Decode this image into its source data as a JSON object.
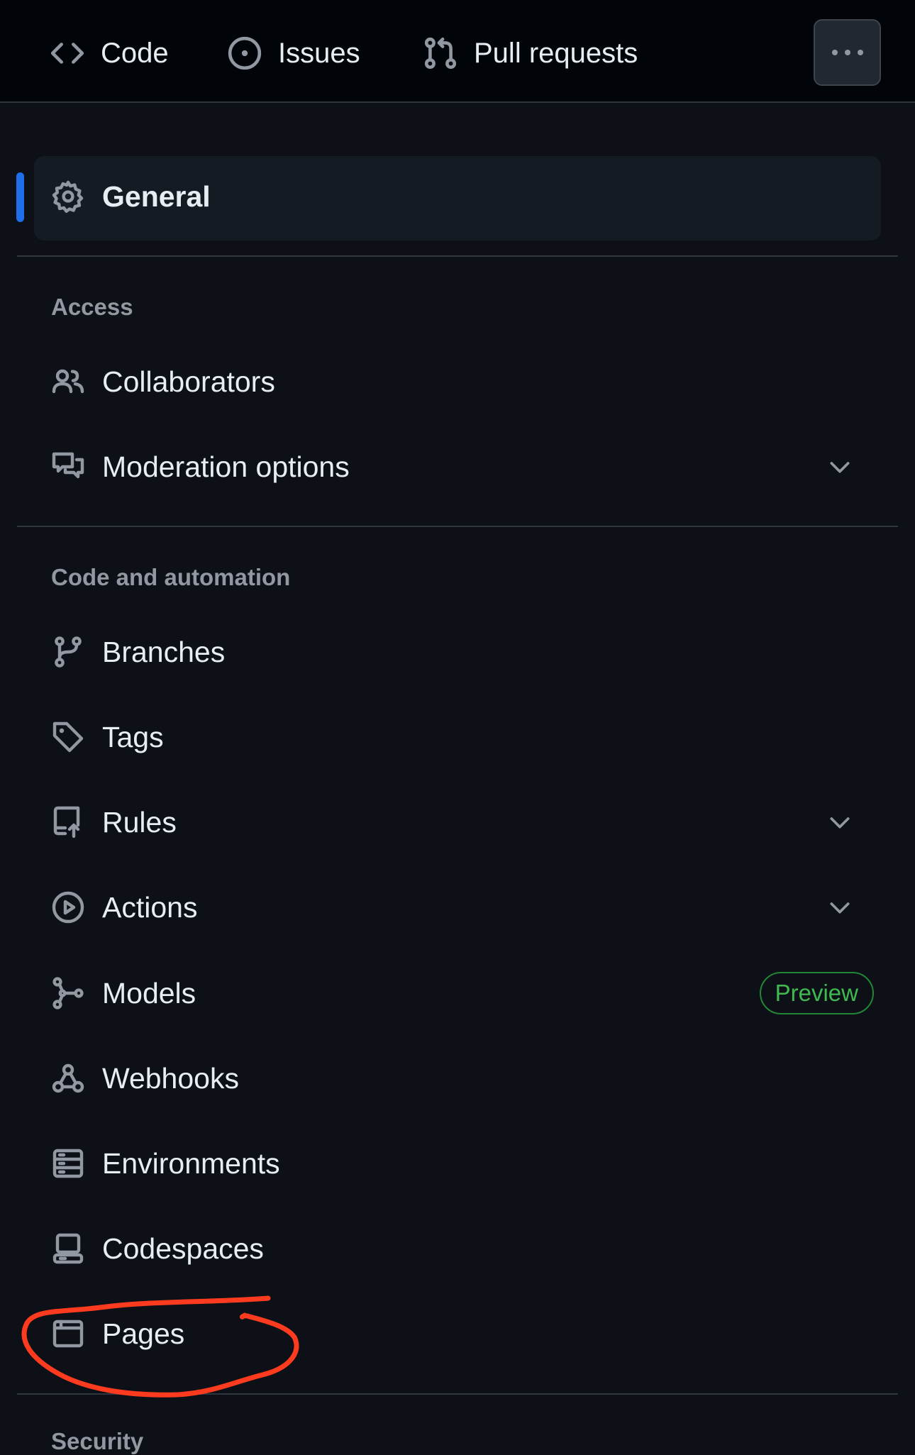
{
  "topbar": {
    "tabs": [
      {
        "label": "Code",
        "icon": "code-icon"
      },
      {
        "label": "Issues",
        "icon": "issue-opened-icon"
      },
      {
        "label": "Pull requests",
        "icon": "git-pull-request-icon"
      }
    ],
    "more_icon": "kebab-horizontal-icon"
  },
  "nav": {
    "general": {
      "label": "General",
      "icon": "gear-icon",
      "selected": true
    },
    "sections": [
      {
        "heading": "Access",
        "items": [
          {
            "label": "Collaborators",
            "icon": "people-icon"
          },
          {
            "label": "Moderation options",
            "icon": "comment-discussion-icon",
            "expandable": true
          }
        ]
      },
      {
        "heading": "Code and automation",
        "items": [
          {
            "label": "Branches",
            "icon": "git-branch-icon"
          },
          {
            "label": "Tags",
            "icon": "tag-icon"
          },
          {
            "label": "Rules",
            "icon": "repo-push-icon",
            "expandable": true
          },
          {
            "label": "Actions",
            "icon": "play-icon",
            "expandable": true
          },
          {
            "label": "Models",
            "icon": "ai-model-icon",
            "badge": "Preview"
          },
          {
            "label": "Webhooks",
            "icon": "webhook-icon"
          },
          {
            "label": "Environments",
            "icon": "server-icon"
          },
          {
            "label": "Codespaces",
            "icon": "codespaces-icon"
          },
          {
            "label": "Pages",
            "icon": "browser-icon"
          }
        ]
      },
      {
        "heading": "Security"
      }
    ]
  },
  "colors": {
    "background": "#0d1117",
    "topbar": "#010409",
    "accent": "#1f6feb",
    "badge_green": "#3fb950",
    "annotation": "#ff3b1f"
  }
}
